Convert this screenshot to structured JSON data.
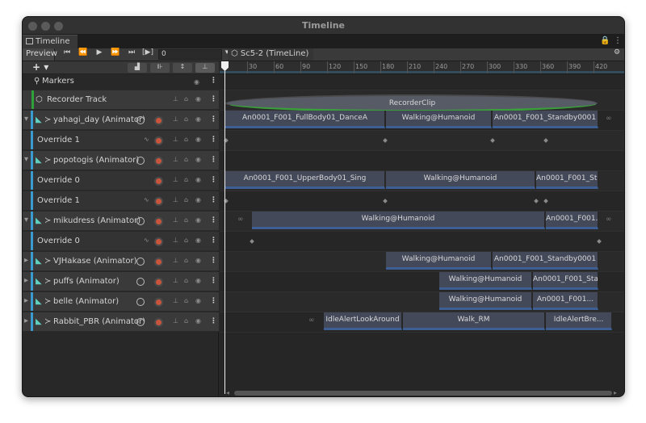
{
  "window": {
    "title": "Timeline"
  },
  "tab": {
    "label": "Timeline",
    "lock": "🔒",
    "menu": "⋮"
  },
  "toolbar": {
    "preview": "Preview",
    "frame_value": "0",
    "breadcrumb": "Sc5-2 (TimeLine)",
    "gear": "⚙",
    "buttons": [
      "⏮",
      "⏪",
      "▶",
      "⏩",
      "⏭",
      "[▶]"
    ]
  },
  "left_header": {
    "add": "+ ▾"
  },
  "ruler": {
    "ticks": [
      "30",
      "60",
      "90",
      "120",
      "150",
      "180",
      "210",
      "240",
      "270",
      "300",
      "330",
      "360",
      "390",
      "420"
    ]
  },
  "markers": {
    "label": "Markers"
  },
  "tracks": [
    {
      "name": "Recorder Track",
      "type": "recorder"
    },
    {
      "name": "yahagi_day (Animator)",
      "type": "animator"
    },
    {
      "name": "Override 1",
      "type": "override"
    },
    {
      "name": "popotogis (Animator)",
      "type": "animator"
    },
    {
      "name": "Override 0",
      "type": "override"
    },
    {
      "name": "Override 1",
      "type": "override"
    },
    {
      "name": "mikudress (Animator)",
      "type": "animator"
    },
    {
      "name": "Override 0",
      "type": "override"
    },
    {
      "name": "VJHakase (Animator)",
      "type": "animator"
    },
    {
      "name": "puffs (Animator)",
      "type": "animator"
    },
    {
      "name": "belle (Animator)",
      "type": "animator"
    },
    {
      "name": "Rabbit_PBR (Animator)",
      "type": "animator"
    }
  ],
  "clips": {
    "recorder": [
      "RecorderClip"
    ],
    "yahagi": [
      "An0001_F001_FullBody01_DanceA",
      "Walking@Humanoid",
      "An0001_F001_Standby0001"
    ],
    "popotogis_o0": [
      "An0001_F001_UpperBody01_Sing",
      "Walking@Humanoid",
      "An0001_F001_St..."
    ],
    "mikudress": [
      "Walking@Humanoid",
      "An0001_F001..."
    ],
    "vjhakase": [
      "Walking@Humanoid",
      "An0001_F001_Standby0001"
    ],
    "puffs": [
      "Walking@Humanoid",
      "An0001_F001_Sta..."
    ],
    "belle": [
      "Walking@Humanoid",
      "An0001_F001..."
    ],
    "rabbit": [
      "IdleAlertLookAround",
      "Walk_RM",
      "IdleAlertBre..."
    ]
  },
  "icons": {
    "infinity": "∞",
    "dots": "⋮"
  }
}
